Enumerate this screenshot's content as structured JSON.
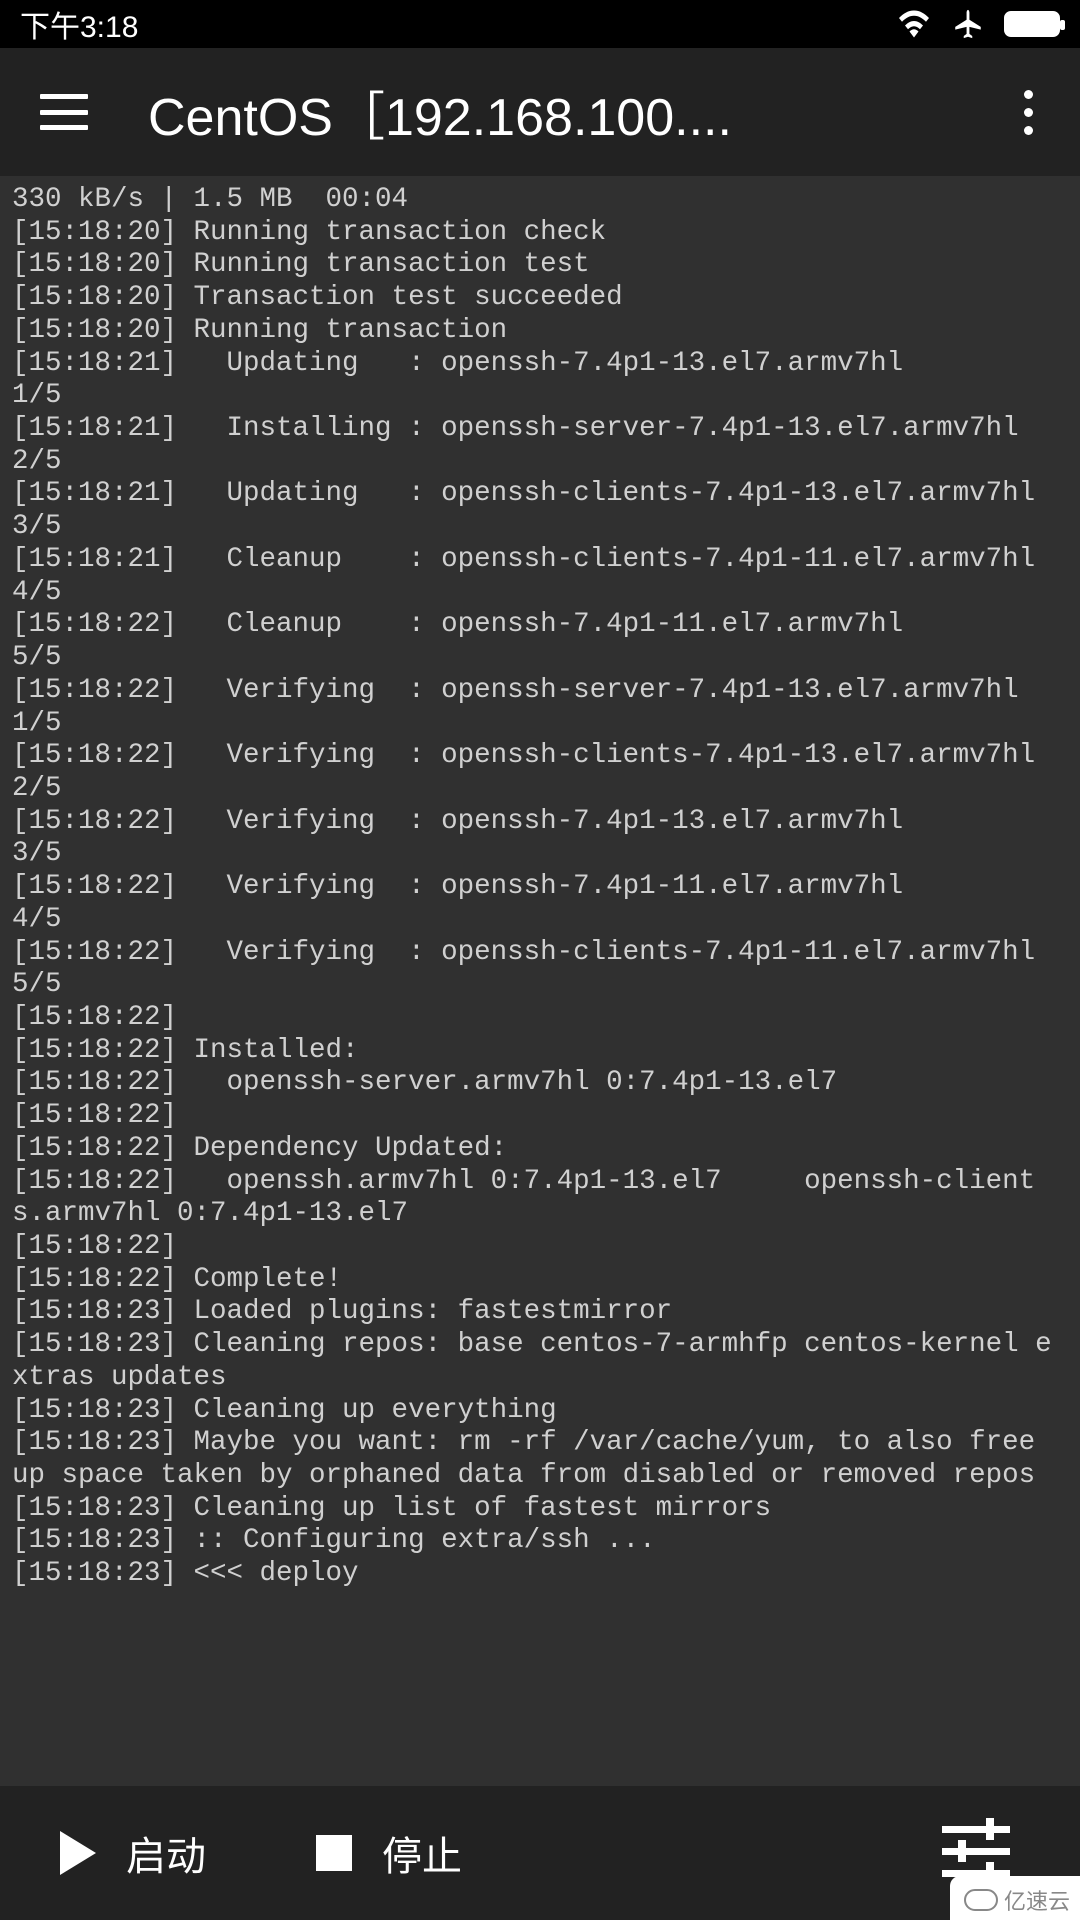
{
  "status": {
    "time": "下午3:18"
  },
  "header": {
    "title": "CentOS［192.168.100...."
  },
  "terminal": {
    "lines": [
      "330 kB/s | 1.5 MB  00:04",
      "[15:18:20] Running transaction check",
      "[15:18:20] Running transaction test",
      "[15:18:20] Transaction test succeeded",
      "[15:18:20] Running transaction",
      "[15:18:21]   Updating   : openssh-7.4p1-13.el7.armv7hl                  1/5",
      "[15:18:21]   Installing : openssh-server-7.4p1-13.el7.armv7hl                           2/5",
      "[15:18:21]   Updating   : openssh-clients-7.4p1-13.el7.armv7hl                          3/5",
      "[15:18:21]   Cleanup    : openssh-clients-7.4p1-11.el7.armv7hl                          4/5",
      "[15:18:22]   Cleanup    : openssh-7.4p1-11.el7.armv7hl                  5/5",
      "[15:18:22]   Verifying  : openssh-server-7.4p1-13.el7.armv7hl                           1/5",
      "[15:18:22]   Verifying  : openssh-clients-7.4p1-13.el7.armv7hl                          2/5",
      "[15:18:22]   Verifying  : openssh-7.4p1-13.el7.armv7hl                  3/5",
      "[15:18:22]   Verifying  : openssh-7.4p1-11.el7.armv7hl                  4/5",
      "[15:18:22]   Verifying  : openssh-clients-7.4p1-11.el7.armv7hl                          5/5",
      "[15:18:22]",
      "[15:18:22] Installed:",
      "[15:18:22]   openssh-server.armv7hl 0:7.4p1-13.el7",
      "[15:18:22]",
      "[15:18:22] Dependency Updated:",
      "[15:18:22]   openssh.armv7hl 0:7.4p1-13.el7     openssh-clients.armv7hl 0:7.4p1-13.el7",
      "[15:18:22]",
      "[15:18:22] Complete!",
      "[15:18:23] Loaded plugins: fastestmirror",
      "[15:18:23] Cleaning repos: base centos-7-armhfp centos-kernel extras updates",
      "[15:18:23] Cleaning up everything",
      "[15:18:23] Maybe you want: rm -rf /var/cache/yum, to also free up space taken by orphaned data from disabled or removed repos",
      "[15:18:23] Cleaning up list of fastest mirrors",
      "[15:18:23] :: Configuring extra/ssh ...",
      "[15:18:23] <<< deploy"
    ]
  },
  "bottom": {
    "start": "启动",
    "stop": "停止"
  },
  "watermark": "亿速云"
}
